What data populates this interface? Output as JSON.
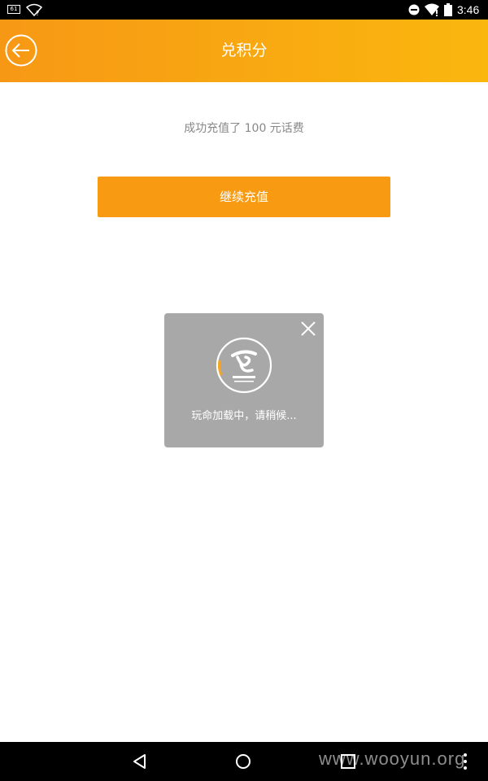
{
  "status_bar": {
    "badge": "61",
    "time": "3:46",
    "icons": [
      "badge-icon",
      "wifi-unknown-icon",
      "do-not-disturb-icon",
      "wifi-icon",
      "battery-icon"
    ]
  },
  "header": {
    "title": "兑积分",
    "back_icon": "arrow-left-icon",
    "background_colors": [
      "#f79815",
      "#fab70e"
    ]
  },
  "content": {
    "success_message": "成功充值了 100 元话费",
    "continue_button_label": "继续充值",
    "button_color": "#f99b12"
  },
  "loading_dialog": {
    "message": "玩命加载中，请稍候...",
    "logo": "china-telecom-logo",
    "close_icon": "close-icon"
  },
  "nav_bar": {
    "icons": [
      "back-triangle-icon",
      "home-circle-icon",
      "recent-apps-icon",
      "menu-dots-icon"
    ],
    "watermark": "www.wooyun.org"
  }
}
